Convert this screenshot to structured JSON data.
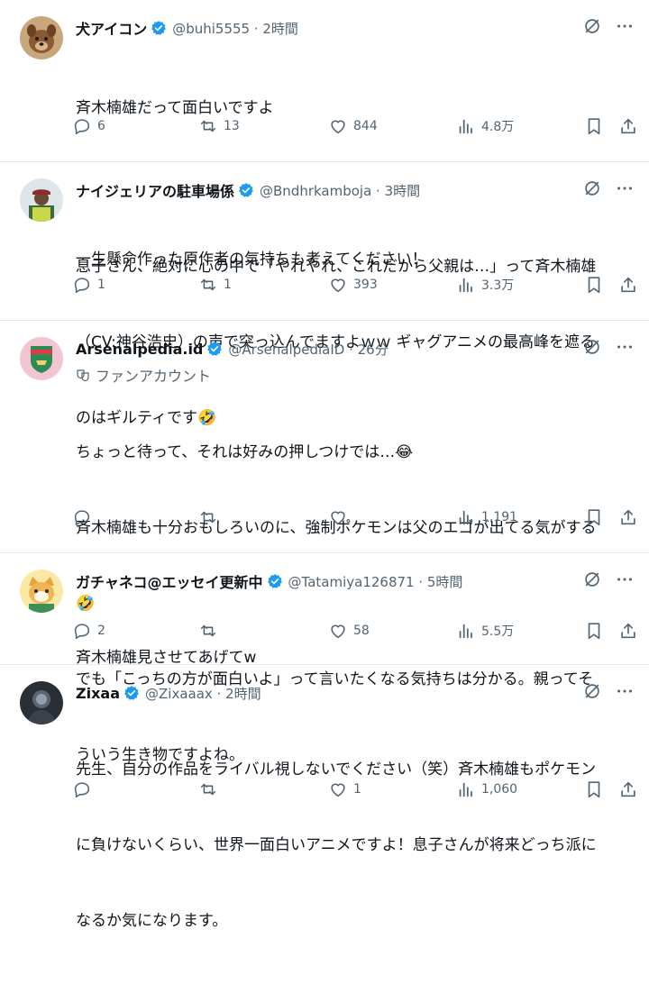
{
  "posts": [
    {
      "name": "犬アイコン",
      "handle": "@buhi5555 · 2時間",
      "fan_label": "",
      "lines": [
        "斉木楠雄だって面白いですよ",
        "",
        "一生懸命作った原作者の気持ちも考えてください！"
      ],
      "replies": "6",
      "reposts": "13",
      "likes": "844",
      "views": "4.8万",
      "avatar_icon": "dog-avatar"
    },
    {
      "name": "ナイジェリアの駐車場係",
      "handle": "@Bndhrkamboja · 3時間",
      "fan_label": "",
      "lines": [
        "息子さん、絶対に心の中で「やれやれ、これだから父親は…」って斉木楠雄",
        "（CV:神谷浩史）の声で突っ込んでますよｗｗ ギャグアニメの最高峰を遮る",
        "のはギルティです🤣"
      ],
      "replies": "1",
      "reposts": "1",
      "likes": "393",
      "views": "3.3万",
      "avatar_icon": "parking-attendant-avatar"
    },
    {
      "name": "Arsenalpedia.id",
      "handle": "@ArsenalpediaID · 26分",
      "fan_label": "ファンアカウント",
      "lines": [
        "ちょっと待って、それは好みの押しつけでは…😂",
        "斉木楠雄も十分おもしろいのに、強制ポケモンは父のエゴが出てる気がする",
        "🤣",
        "でも「こっちの方が面白いよ」って言いたくなる気持ちは分かる。親ってそ",
        "ういう生き物ですよね。"
      ],
      "replies": "",
      "reposts": "",
      "likes": "",
      "views": "1,191",
      "avatar_icon": "arsenal-crest-avatar"
    },
    {
      "name": "ガチャネコ@エッセイ更新中",
      "handle": "@Tatamiya126871 · 5時間",
      "fan_label": "",
      "lines": [
        "斉木楠雄見させてあげてw"
      ],
      "replies": "2",
      "reposts": "",
      "likes": "58",
      "views": "5.5万",
      "avatar_icon": "cat-avatar"
    },
    {
      "name": "Zixaa",
      "handle": "@Zixaaax · 2時間",
      "fan_label": "",
      "lines": [
        "先生、自分の作品をライバル視しないでください（笑）斉木楠雄もポケモン",
        "に負けないくらい、世界一面白いアニメですよ！息子さんが将来どっち派に",
        "なるか気になります。"
      ],
      "replies": "",
      "reposts": "",
      "likes": "1",
      "views": "1,060",
      "avatar_icon": "dark-avatar"
    }
  ],
  "colors": {
    "text": "#0f1419",
    "muted": "#536471",
    "verified": "#1d9bf0",
    "divider": "#e6e9ec"
  }
}
